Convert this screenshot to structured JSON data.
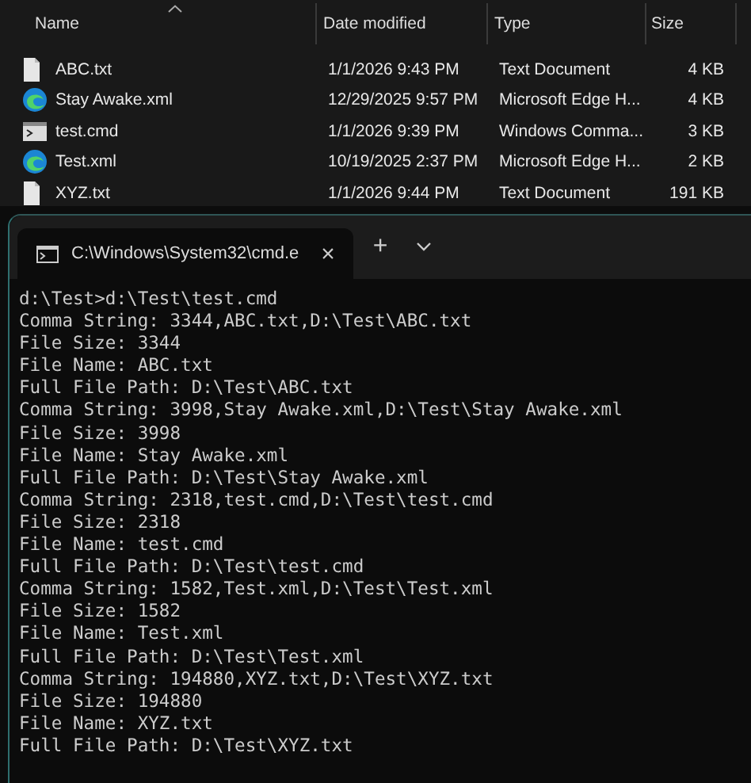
{
  "explorer": {
    "columns": [
      {
        "label": "Name",
        "sorted": true
      },
      {
        "label": "Date modified",
        "sorted": false
      },
      {
        "label": "Type",
        "sorted": false
      },
      {
        "label": "Size",
        "sorted": false
      }
    ],
    "files": [
      {
        "kind": "text",
        "name": "ABC.txt",
        "date": "1/1/2026 9:43 PM",
        "type": "Text Document",
        "size": "4 KB"
      },
      {
        "kind": "edge",
        "name": "Stay Awake.xml",
        "date": "12/29/2025 9:57 PM",
        "type": "Microsoft Edge H...",
        "size": "4 KB"
      },
      {
        "kind": "cmd",
        "name": "test.cmd",
        "date": "1/1/2026 9:39 PM",
        "type": "Windows Comma...",
        "size": "3 KB"
      },
      {
        "kind": "edge",
        "name": "Test.xml",
        "date": "10/19/2025 2:37 PM",
        "type": "Microsoft Edge H...",
        "size": "2 KB"
      },
      {
        "kind": "text",
        "name": "XYZ.txt",
        "date": "1/1/2026 9:44 PM",
        "type": "Text Document",
        "size": "191 KB"
      }
    ]
  },
  "terminal": {
    "tabs": [
      {
        "title": "C:\\Windows\\System32\\cmd.e",
        "close": "×",
        "selected": true
      }
    ],
    "new_tab": "+",
    "output": [
      "d:\\Test>d:\\Test\\test.cmd",
      "Comma String: 3344,ABC.txt,D:\\Test\\ABC.txt",
      "File Size: 3344",
      "File Name: ABC.txt",
      "Full File Path: D:\\Test\\ABC.txt",
      "Comma String: 3998,Stay Awake.xml,D:\\Test\\Stay Awake.xml",
      "File Size: 3998",
      "File Name: Stay Awake.xml",
      "Full File Path: D:\\Test\\Stay Awake.xml",
      "Comma String: 2318,test.cmd,D:\\Test\\test.cmd",
      "File Size: 2318",
      "File Name: test.cmd",
      "Full File Path: D:\\Test\\test.cmd",
      "Comma String: 1582,Test.xml,D:\\Test\\Test.xml",
      "File Size: 1582",
      "File Name: Test.xml",
      "Full File Path: D:\\Test\\Test.xml",
      "Comma String: 194880,XYZ.txt,D:\\Test\\XYZ.txt",
      "File Size: 194880",
      "File Name: XYZ.txt",
      "Full File Path: D:\\Test\\XYZ.txt"
    ]
  }
}
